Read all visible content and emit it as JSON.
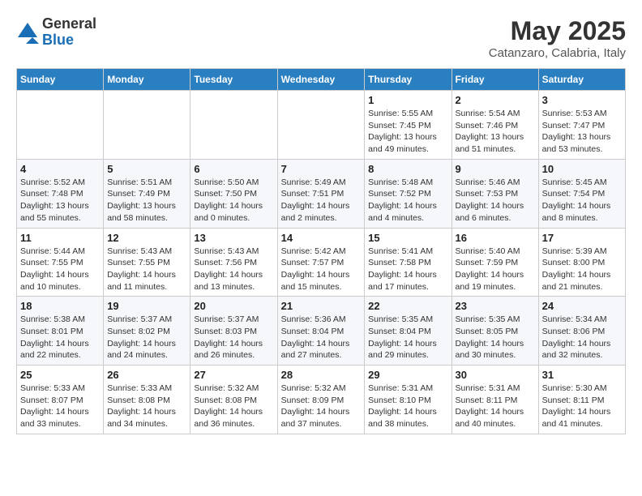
{
  "logo": {
    "general": "General",
    "blue": "Blue"
  },
  "title": {
    "month_year": "May 2025",
    "location": "Catanzaro, Calabria, Italy"
  },
  "days_of_week": [
    "Sunday",
    "Monday",
    "Tuesday",
    "Wednesday",
    "Thursday",
    "Friday",
    "Saturday"
  ],
  "weeks": [
    [
      {
        "day": "",
        "info": ""
      },
      {
        "day": "",
        "info": ""
      },
      {
        "day": "",
        "info": ""
      },
      {
        "day": "",
        "info": ""
      },
      {
        "day": "1",
        "info": "Sunrise: 5:55 AM\nSunset: 7:45 PM\nDaylight: 13 hours\nand 49 minutes."
      },
      {
        "day": "2",
        "info": "Sunrise: 5:54 AM\nSunset: 7:46 PM\nDaylight: 13 hours\nand 51 minutes."
      },
      {
        "day": "3",
        "info": "Sunrise: 5:53 AM\nSunset: 7:47 PM\nDaylight: 13 hours\nand 53 minutes."
      }
    ],
    [
      {
        "day": "4",
        "info": "Sunrise: 5:52 AM\nSunset: 7:48 PM\nDaylight: 13 hours\nand 55 minutes."
      },
      {
        "day": "5",
        "info": "Sunrise: 5:51 AM\nSunset: 7:49 PM\nDaylight: 13 hours\nand 58 minutes."
      },
      {
        "day": "6",
        "info": "Sunrise: 5:50 AM\nSunset: 7:50 PM\nDaylight: 14 hours\nand 0 minutes."
      },
      {
        "day": "7",
        "info": "Sunrise: 5:49 AM\nSunset: 7:51 PM\nDaylight: 14 hours\nand 2 minutes."
      },
      {
        "day": "8",
        "info": "Sunrise: 5:48 AM\nSunset: 7:52 PM\nDaylight: 14 hours\nand 4 minutes."
      },
      {
        "day": "9",
        "info": "Sunrise: 5:46 AM\nSunset: 7:53 PM\nDaylight: 14 hours\nand 6 minutes."
      },
      {
        "day": "10",
        "info": "Sunrise: 5:45 AM\nSunset: 7:54 PM\nDaylight: 14 hours\nand 8 minutes."
      }
    ],
    [
      {
        "day": "11",
        "info": "Sunrise: 5:44 AM\nSunset: 7:55 PM\nDaylight: 14 hours\nand 10 minutes."
      },
      {
        "day": "12",
        "info": "Sunrise: 5:43 AM\nSunset: 7:55 PM\nDaylight: 14 hours\nand 11 minutes."
      },
      {
        "day": "13",
        "info": "Sunrise: 5:43 AM\nSunset: 7:56 PM\nDaylight: 14 hours\nand 13 minutes."
      },
      {
        "day": "14",
        "info": "Sunrise: 5:42 AM\nSunset: 7:57 PM\nDaylight: 14 hours\nand 15 minutes."
      },
      {
        "day": "15",
        "info": "Sunrise: 5:41 AM\nSunset: 7:58 PM\nDaylight: 14 hours\nand 17 minutes."
      },
      {
        "day": "16",
        "info": "Sunrise: 5:40 AM\nSunset: 7:59 PM\nDaylight: 14 hours\nand 19 minutes."
      },
      {
        "day": "17",
        "info": "Sunrise: 5:39 AM\nSunset: 8:00 PM\nDaylight: 14 hours\nand 21 minutes."
      }
    ],
    [
      {
        "day": "18",
        "info": "Sunrise: 5:38 AM\nSunset: 8:01 PM\nDaylight: 14 hours\nand 22 minutes."
      },
      {
        "day": "19",
        "info": "Sunrise: 5:37 AM\nSunset: 8:02 PM\nDaylight: 14 hours\nand 24 minutes."
      },
      {
        "day": "20",
        "info": "Sunrise: 5:37 AM\nSunset: 8:03 PM\nDaylight: 14 hours\nand 26 minutes."
      },
      {
        "day": "21",
        "info": "Sunrise: 5:36 AM\nSunset: 8:04 PM\nDaylight: 14 hours\nand 27 minutes."
      },
      {
        "day": "22",
        "info": "Sunrise: 5:35 AM\nSunset: 8:04 PM\nDaylight: 14 hours\nand 29 minutes."
      },
      {
        "day": "23",
        "info": "Sunrise: 5:35 AM\nSunset: 8:05 PM\nDaylight: 14 hours\nand 30 minutes."
      },
      {
        "day": "24",
        "info": "Sunrise: 5:34 AM\nSunset: 8:06 PM\nDaylight: 14 hours\nand 32 minutes."
      }
    ],
    [
      {
        "day": "25",
        "info": "Sunrise: 5:33 AM\nSunset: 8:07 PM\nDaylight: 14 hours\nand 33 minutes."
      },
      {
        "day": "26",
        "info": "Sunrise: 5:33 AM\nSunset: 8:08 PM\nDaylight: 14 hours\nand 34 minutes."
      },
      {
        "day": "27",
        "info": "Sunrise: 5:32 AM\nSunset: 8:08 PM\nDaylight: 14 hours\nand 36 minutes."
      },
      {
        "day": "28",
        "info": "Sunrise: 5:32 AM\nSunset: 8:09 PM\nDaylight: 14 hours\nand 37 minutes."
      },
      {
        "day": "29",
        "info": "Sunrise: 5:31 AM\nSunset: 8:10 PM\nDaylight: 14 hours\nand 38 minutes."
      },
      {
        "day": "30",
        "info": "Sunrise: 5:31 AM\nSunset: 8:11 PM\nDaylight: 14 hours\nand 40 minutes."
      },
      {
        "day": "31",
        "info": "Sunrise: 5:30 AM\nSunset: 8:11 PM\nDaylight: 14 hours\nand 41 minutes."
      }
    ]
  ]
}
